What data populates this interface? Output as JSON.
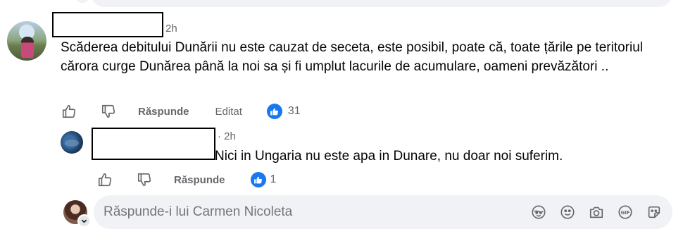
{
  "comment": {
    "author": "",
    "time": "2h",
    "text": "Scăderea debitului Dunării nu este cauzat de seceta, este posibil, poate că, toate țările pe teritoriul cărora curge Dunărea până la noi sa și fi umplut lacurile de acumulare, oameni prevăzători ..",
    "actions": {
      "reply": "Răspunde",
      "edited": "Editat"
    },
    "like_count": "31"
  },
  "reply": {
    "author": "",
    "time": "· 2h",
    "text": "Nici in Ungaria nu este apa in Dunare, nu doar noi suferim.",
    "actions": {
      "reply": "Răspunde"
    },
    "like_count": "1"
  },
  "composer": {
    "placeholder": "Răspunde-i lui Carmen Nicoleta",
    "icons": [
      "avatar-sticker-icon",
      "emoji-icon",
      "camera-icon",
      "gif-icon",
      "sticker-icon"
    ]
  },
  "colors": {
    "like_blue": "#1877f2",
    "muted": "#65676b",
    "bubble": "#f0f2f5"
  }
}
